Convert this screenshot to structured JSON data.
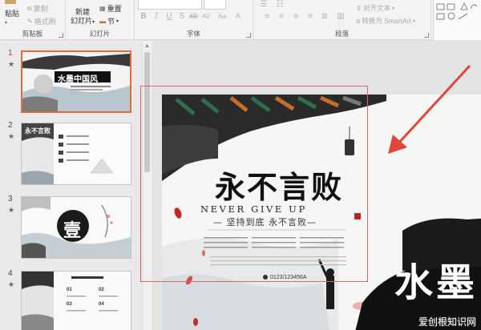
{
  "ribbon": {
    "clipboard": {
      "paste": "粘贴",
      "copy": "复制",
      "format_painter": "格式刷",
      "label": "剪贴板"
    },
    "slides": {
      "new_slide_line1": "新建",
      "new_slide_line2": "幻灯片",
      "reset": "重置",
      "section": "节",
      "label": "幻灯片"
    },
    "font": {
      "size_label": "Aa",
      "label": "字体"
    },
    "paragraph": {
      "label": "段落"
    },
    "drawing": {
      "align_text": "对齐文本",
      "convert_smartart": "转换为 SmartArt"
    }
  },
  "thumbnails": [
    {
      "number": "1",
      "star": "★",
      "title": "水墨中国风"
    },
    {
      "number": "2",
      "star": "★",
      "title": "永不言败"
    },
    {
      "number": "3",
      "star": "★",
      "title": "壹"
    },
    {
      "number": "4",
      "star": "★",
      "title": "",
      "nums": [
        "01",
        "02",
        "03",
        "04"
      ]
    }
  ],
  "slide": {
    "title_chars": "永不言败",
    "never_give_up": "NEVER GIVE UP",
    "slogan": "— 坚持到底 永不言败—",
    "phone": "0123/123456A",
    "big_title": "水墨"
  },
  "watermark": "爱创根知识网",
  "colors": {
    "accent": "#d8703e",
    "arrow": "#e0453a",
    "selection": "#d46a6a"
  }
}
